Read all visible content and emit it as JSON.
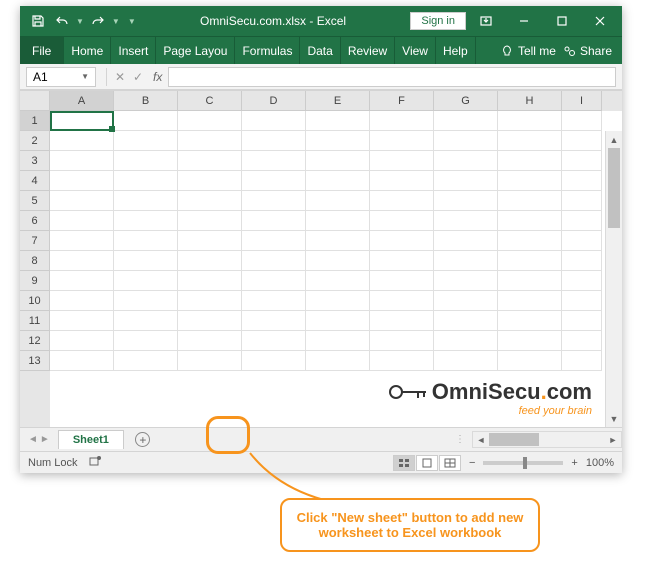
{
  "titlebar": {
    "title": "OmniSecu.com.xlsx - Excel",
    "signin": "Sign in"
  },
  "ribbon": {
    "file": "File",
    "tabs": [
      "Home",
      "Insert",
      "Page Layou",
      "Formulas",
      "Data",
      "Review",
      "View",
      "Help"
    ],
    "tellme": "Tell me",
    "share": "Share"
  },
  "formula": {
    "namebox": "A1",
    "fx": "fx"
  },
  "grid": {
    "cols": [
      "A",
      "B",
      "C",
      "D",
      "E",
      "F",
      "G",
      "H",
      "I"
    ],
    "rows": [
      "1",
      "2",
      "3",
      "4",
      "5",
      "6",
      "7",
      "8",
      "9",
      "10",
      "11",
      "12",
      "13"
    ]
  },
  "watermark": {
    "prefix": "Omni",
    "suffix": "Secu",
    "dot": ".",
    "tld": "com",
    "sub": "feed your brain"
  },
  "sheets": {
    "active": "Sheet1"
  },
  "status": {
    "numlock": "Num Lock",
    "zoom": "100%"
  },
  "callout": {
    "text": "Click \"New sheet\" button to add new worksheet to Excel workbook"
  }
}
